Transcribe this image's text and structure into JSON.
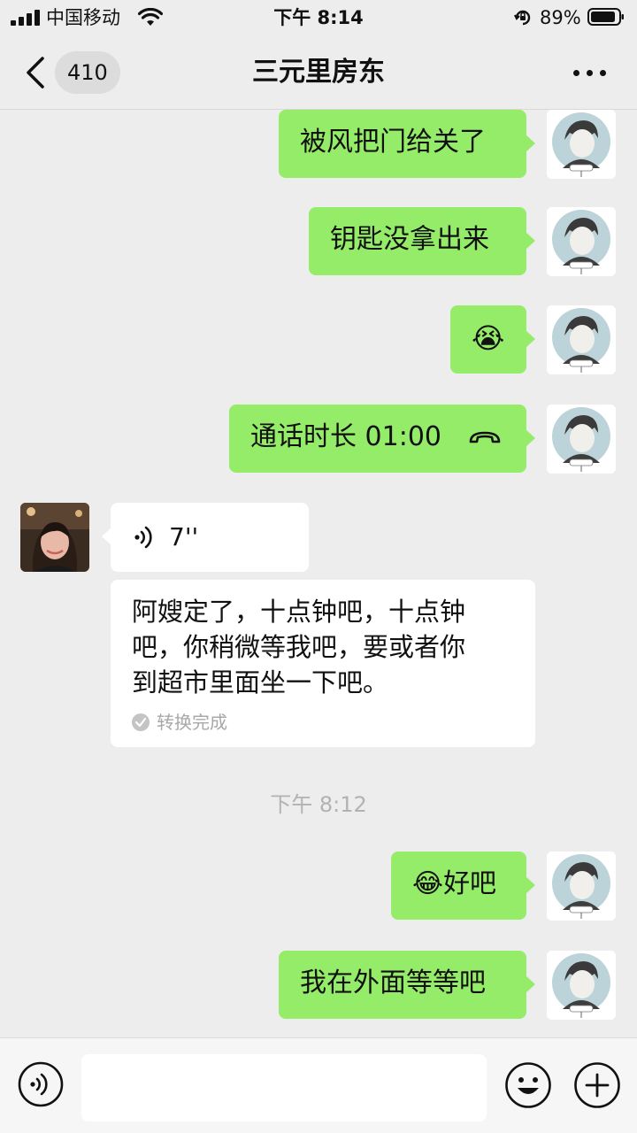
{
  "status_bar": {
    "carrier": "中国移动",
    "time": "下午 8:14",
    "battery": "89%"
  },
  "header": {
    "unread_count": "410",
    "title": "三元里房东"
  },
  "messages": [
    {
      "side": "right",
      "type": "text",
      "text": "被风把门给关了"
    },
    {
      "side": "right",
      "type": "text",
      "text": "钥匙没拿出来"
    },
    {
      "side": "right",
      "type": "emoji",
      "emoji": "😭"
    },
    {
      "side": "right",
      "type": "call",
      "text": "通话时长 01:00"
    },
    {
      "side": "left",
      "type": "voice",
      "duration": "7''"
    },
    {
      "side": "left",
      "type": "transcript",
      "lines": [
        "阿嫂定了，十点钟吧，十点钟",
        "吧，你稍微等我吧，要或者你",
        "到超市里面坐一下吧。"
      ],
      "status": "转换完成"
    },
    {
      "type": "time",
      "text": "下午 8:12"
    },
    {
      "side": "right",
      "type": "text",
      "emoji": "😂",
      "text": "好吧"
    },
    {
      "side": "right",
      "type": "text",
      "text": "我在外面等等吧"
    }
  ],
  "input": {
    "placeholder": ""
  },
  "colors": {
    "background": "#ededed",
    "sent_bubble": "#95ec69",
    "received_bubble": "#ffffff"
  }
}
